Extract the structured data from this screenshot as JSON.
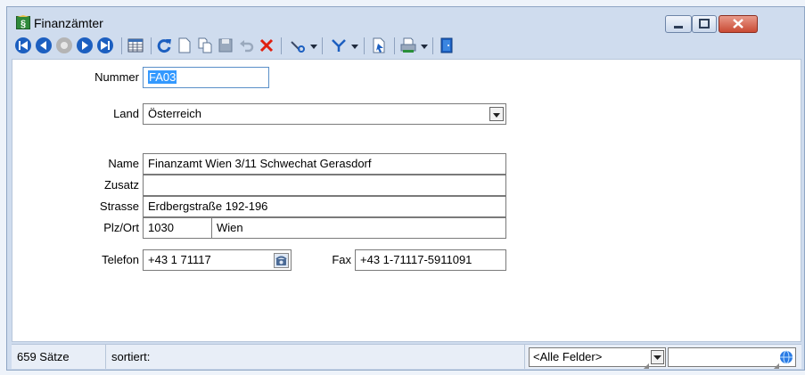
{
  "window": {
    "title": "Finanzämter",
    "controls": [
      "minimize",
      "maximize",
      "close"
    ]
  },
  "toolbar": {
    "items": [
      {
        "icon": "first-record-icon"
      },
      {
        "icon": "previous-record-icon"
      },
      {
        "icon": "record-icon"
      },
      {
        "icon": "next-record-icon"
      },
      {
        "icon": "last-record-icon"
      },
      {
        "icon": "table-view-icon"
      },
      {
        "icon": "refresh-icon"
      },
      {
        "icon": "new-record-icon"
      },
      {
        "icon": "copy-record-icon"
      },
      {
        "icon": "save-icon"
      },
      {
        "icon": "undo-icon"
      },
      {
        "icon": "delete-icon"
      },
      {
        "icon": "tools-icon"
      },
      {
        "icon": "filter-icon"
      },
      {
        "icon": "export-icon"
      },
      {
        "icon": "print-icon"
      },
      {
        "icon": "exit-icon"
      }
    ],
    "colors": {
      "blue": "#1c5fc0",
      "red": "#e02010"
    }
  },
  "form": {
    "nummer_label": "Nummer",
    "nummer_value": "FA03",
    "land_label": "Land",
    "land_value": "Österreich",
    "name_label": "Name",
    "name_value": "Finanzamt Wien 3/11 Schwechat Gerasdorf",
    "zusatz_label": "Zusatz",
    "zusatz_value": "",
    "strasse_label": "Strasse",
    "strasse_value": "Erdbergstraße 192-196",
    "plzort_label": "Plz/Ort",
    "plz_value": "1030",
    "ort_value": "Wien",
    "telefon_label": "Telefon",
    "telefon_value": "+43 1 71117",
    "fax_label": "Fax",
    "fax_value": "+43 1-71117-5911091"
  },
  "statusbar": {
    "count": "659 Sätze",
    "sorted": "sortiert:",
    "field_filter": "<Alle Felder>",
    "search_value": ""
  }
}
